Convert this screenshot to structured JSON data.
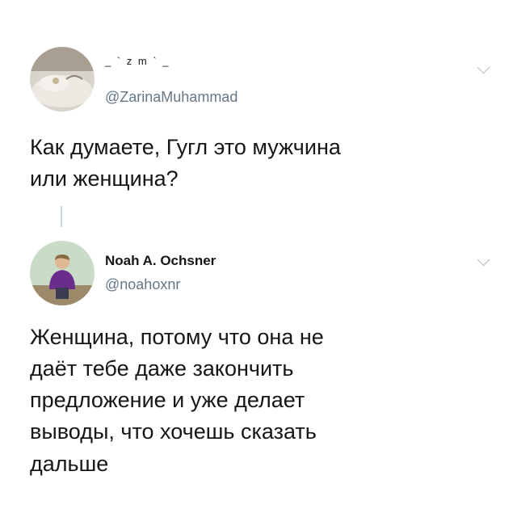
{
  "tweets": [
    {
      "display_name": "_ ` z m ` _",
      "handle": "@ZarinaMuhammad",
      "text": "Как думаете, Гугл это мужчина\nили женщина?",
      "avatar_icon": "bed-pillow-photo"
    },
    {
      "display_name": "Noah A. Ochsner",
      "handle": "@noahoxnr",
      "text": "Женщина, потому что она не\nдаёт тебе даже закончить\nпредложение и уже делает\nвыводы, что хочешь сказать\nдальше",
      "avatar_icon": "person-photo"
    }
  ],
  "colors": {
    "text": "#14171a",
    "secondary": "#657786",
    "chevron": "#aab8c2",
    "thread_line": "#ccd6dd"
  }
}
